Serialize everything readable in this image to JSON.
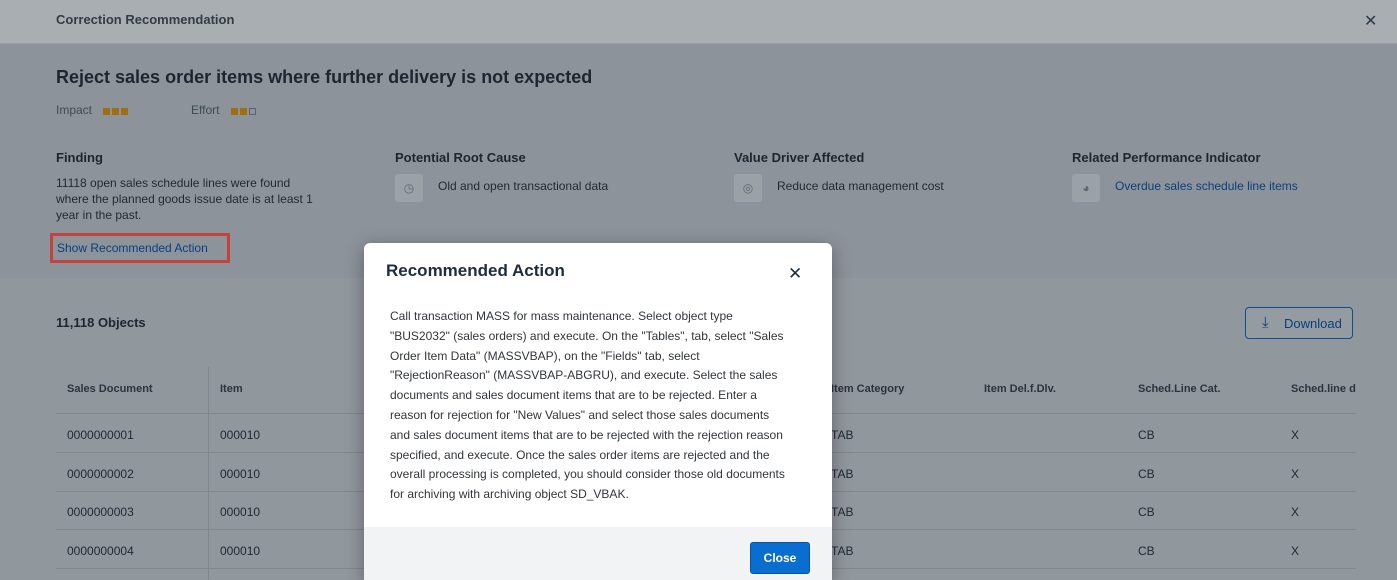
{
  "dialog_header": {
    "title": "Correction Recommendation",
    "close_glyph": "✕"
  },
  "recommendation": {
    "title": "Reject sales order items where further delivery is not expected",
    "impact": {
      "label": "Impact",
      "level": 3,
      "max": 3
    },
    "effort": {
      "label": "Effort",
      "level": 2,
      "max": 3
    },
    "finding": {
      "heading": "Finding",
      "lines": [
        "11118 open sales schedule lines were found",
        "where the planned goods issue date is at least 1",
        "year in the past."
      ]
    },
    "root_cause": {
      "heading": "Potential Root Cause",
      "text": "Old and open transactional data",
      "icon": "clock-icon"
    },
    "value_driver": {
      "heading": "Value Driver Affected",
      "text": "Reduce data management cost",
      "icon": "target-icon"
    },
    "indicator": {
      "heading": "Related Performance Indicator",
      "text": "Overdue sales schedule line items",
      "icon": "gauge-icon"
    },
    "show_action_link": "Show Recommended Action"
  },
  "objects": {
    "count_label": "11,118 Objects",
    "download_label": "Download",
    "columns": {
      "sales_document": "Sales Document",
      "item": "Item",
      "item_category": "Item Category",
      "item_del": "Item Del.f.Dlv.",
      "sched_line_cat": "Sched.Line Cat.",
      "sched_line_d": "Sched.line d"
    },
    "rows": [
      {
        "sales_document": "0000000001",
        "item": "000010",
        "item_category": "TAB",
        "item_del": "",
        "sched_line_cat": "CB",
        "sched_line_d": "X"
      },
      {
        "sales_document": "0000000002",
        "item": "000010",
        "item_category": "TAB",
        "item_del": "",
        "sched_line_cat": "CB",
        "sched_line_d": "X"
      },
      {
        "sales_document": "0000000003",
        "item": "000010",
        "item_category": "TAB",
        "item_del": "",
        "sched_line_cat": "CB",
        "sched_line_d": "X"
      },
      {
        "sales_document": "0000000004",
        "item": "000010",
        "item_category": "TAB",
        "item_del": "",
        "sched_line_cat": "CB",
        "sched_line_d": "X"
      }
    ]
  },
  "modal": {
    "title": "Recommended Action",
    "close_glyph": "✕",
    "body_lines": [
      "Call transaction MASS for mass maintenance. Select object type",
      "\"BUS2032\" (sales orders) and execute. On the \"Tables\", tab, select \"Sales",
      "Order Item Data\" (MASSVBAP), on the \"Fields\" tab, select",
      "\"RejectionReason\" (MASSVBAP-ABGRU), and execute. Select the sales",
      "documents and sales document items that are to be rejected. Enter a",
      "reason for rejection for \"New Values\" and select those sales documents",
      "and sales document items that are to be rejected with the rejection reason",
      "specified, and execute. Once the sales order items are rejected and the",
      "overall processing is completed, you should consider those old documents",
      "for archiving with archiving object SD_VBAK."
    ],
    "close_button": "Close"
  },
  "colors": {
    "accent": "#0a6ed1",
    "link": "#0b3f7c",
    "highlight_border": "#c5423c",
    "rating": "#a06d10"
  }
}
